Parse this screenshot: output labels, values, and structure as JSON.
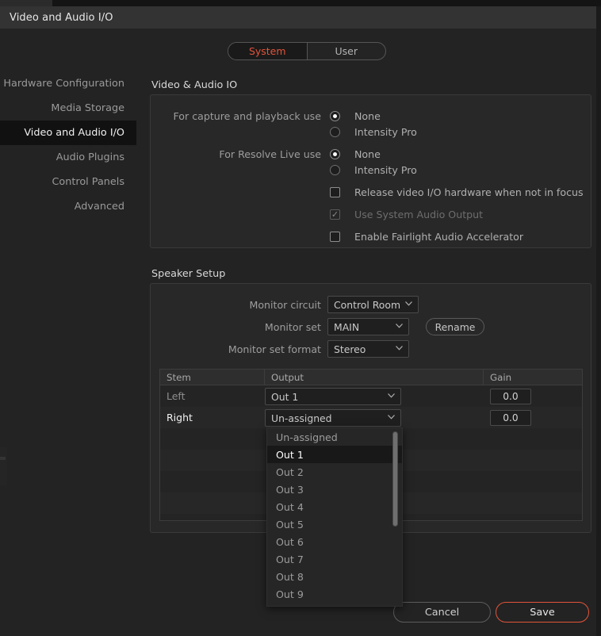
{
  "window": {
    "title": "Video and Audio I/O"
  },
  "tabs": {
    "system": "System",
    "user": "User",
    "active": "System",
    "active_color": "#e2543a"
  },
  "sidebar": {
    "items": [
      {
        "label": "Hardware Configuration",
        "active": false
      },
      {
        "label": "Media Storage",
        "active": false
      },
      {
        "label": "Video and Audio I/O",
        "active": true
      },
      {
        "label": "Audio Plugins",
        "active": false
      },
      {
        "label": "Control Panels",
        "active": false
      },
      {
        "label": "Advanced",
        "active": false
      }
    ]
  },
  "video_audio_io": {
    "section_title": "Video & Audio IO",
    "capture_label": "For capture and playback use",
    "capture_options": [
      {
        "label": "None",
        "selected": true
      },
      {
        "label": "Intensity Pro",
        "selected": false
      }
    ],
    "live_label": "For Resolve Live use",
    "live_options": [
      {
        "label": "None",
        "selected": true
      },
      {
        "label": "Intensity Pro",
        "selected": false
      }
    ],
    "checkboxes": [
      {
        "label": "Release video I/O hardware when not in focus",
        "checked": false,
        "disabled": false
      },
      {
        "label": "Use System Audio Output",
        "checked": true,
        "disabled": true
      },
      {
        "label": "Enable Fairlight Audio Accelerator",
        "checked": false,
        "disabled": false
      }
    ]
  },
  "speaker_setup": {
    "section_title": "Speaker Setup",
    "monitor_circuit_label": "Monitor circuit",
    "monitor_circuit_value": "Control Room",
    "monitor_set_label": "Monitor set",
    "monitor_set_value": "MAIN",
    "rename_label": "Rename",
    "monitor_set_format_label": "Monitor set format",
    "monitor_set_format_value": "Stereo",
    "table": {
      "columns": [
        "Stem",
        "Output",
        "Gain"
      ],
      "rows": [
        {
          "stem": "Left",
          "output": "Out 1",
          "gain": "0.0",
          "selected": false
        },
        {
          "stem": "Right",
          "output": "Un-assigned",
          "gain": "0.0",
          "selected": true
        }
      ],
      "empty_row_count": 5
    }
  },
  "output_dropdown": {
    "open": true,
    "options": [
      {
        "label": "Un-assigned",
        "highlighted": false
      },
      {
        "label": "Out 1",
        "highlighted": true
      },
      {
        "label": "Out 2",
        "highlighted": false
      },
      {
        "label": "Out 3",
        "highlighted": false
      },
      {
        "label": "Out 4",
        "highlighted": false
      },
      {
        "label": "Out 5",
        "highlighted": false
      },
      {
        "label": "Out 6",
        "highlighted": false
      },
      {
        "label": "Out 7",
        "highlighted": false
      },
      {
        "label": "Out 8",
        "highlighted": false
      },
      {
        "label": "Out 9",
        "highlighted": false
      }
    ]
  },
  "footer": {
    "cancel_label": "Cancel",
    "save_label": "Save",
    "save_accent": "#e2543a"
  },
  "icons": {
    "caret": "⌄",
    "check": "✓"
  }
}
